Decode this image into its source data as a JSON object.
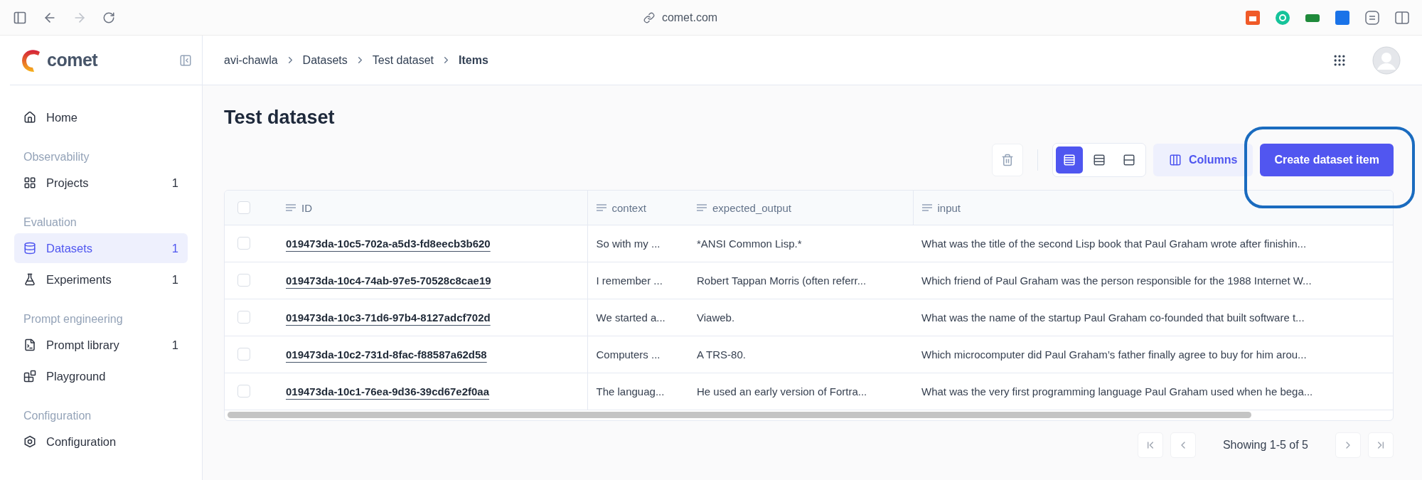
{
  "browser": {
    "url": "comet.com"
  },
  "logo": {
    "text": "comet"
  },
  "breadcrumbs": [
    {
      "label": "avi-chawla",
      "current": false
    },
    {
      "label": "Datasets",
      "current": false
    },
    {
      "label": "Test dataset",
      "current": false
    },
    {
      "label": "Items",
      "current": true
    }
  ],
  "sidebar": {
    "sections": [
      {
        "items": [
          {
            "label": "Home",
            "selected": false
          }
        ]
      },
      {
        "title": "Observability",
        "items": [
          {
            "label": "Projects",
            "count": "1",
            "selected": false
          }
        ]
      },
      {
        "title": "Evaluation",
        "items": [
          {
            "label": "Datasets",
            "count": "1",
            "selected": true
          },
          {
            "label": "Experiments",
            "count": "1",
            "selected": false
          }
        ]
      },
      {
        "title": "Prompt engineering",
        "items": [
          {
            "label": "Prompt library",
            "count": "1",
            "selected": false
          },
          {
            "label": "Playground",
            "selected": false
          }
        ]
      },
      {
        "title": "Configuration",
        "items": [
          {
            "label": "Configuration",
            "selected": false
          }
        ]
      }
    ]
  },
  "page_title": "Test dataset",
  "toolbar": {
    "view_modes": [
      {
        "selected": true
      },
      {
        "selected": false
      },
      {
        "selected": false
      }
    ],
    "columns_button": "Columns",
    "create_button": "Create dataset item"
  },
  "table": {
    "header_checked": false,
    "columns": [
      "ID",
      "context",
      "expected_output",
      "input"
    ],
    "rows": [
      {
        "checked": false,
        "cells": [
          "019473da-10c5-702a-a5d3-fd8eecb3b620",
          "So with my ...",
          "*ANSI Common Lisp.*",
          "What was the title of the second Lisp book that Paul Graham wrote after finishin..."
        ]
      },
      {
        "checked": false,
        "cells": [
          "019473da-10c4-74ab-97e5-70528c8cae19",
          "I remember ...",
          "Robert Tappan Morris (often referr...",
          "Which friend of Paul Graham was the person responsible for the 1988 Internet W..."
        ]
      },
      {
        "checked": false,
        "cells": [
          "019473da-10c3-71d6-97b4-8127adcf702d",
          "We started a...",
          "Viaweb.",
          "What was the name of the startup Paul Graham co-founded that built software t..."
        ]
      },
      {
        "checked": false,
        "cells": [
          "019473da-10c2-731d-8fac-f88587a62d58",
          "Computers ...",
          "A TRS-80.",
          "Which microcomputer did Paul Graham’s father finally agree to buy for him arou..."
        ]
      },
      {
        "checked": false,
        "cells": [
          "019473da-10c1-76ea-9d36-39cd67e2f0aa",
          "The languag...",
          "He used an early version of Fortra...",
          "What was the very first programming language Paul Graham used when he bega..."
        ]
      }
    ]
  },
  "pagination": {
    "text": "Showing 1-5 of 5"
  }
}
